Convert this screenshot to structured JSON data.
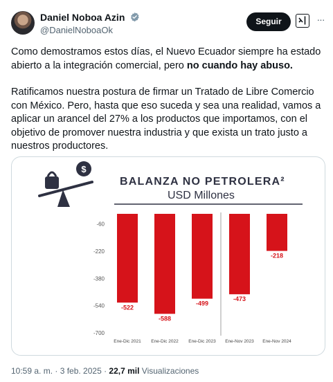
{
  "author": {
    "display_name": "Daniel Noboa Azin",
    "handle": "@DanielNoboaOk"
  },
  "actions": {
    "follow_label": "Seguir",
    "more_label": "···"
  },
  "tweet": {
    "paragraph1_pre": "Como demostramos estos días, el Nuevo Ecuador siempre ha estado abierto a la integración comercial, pero ",
    "paragraph1_bold": "no cuando hay abuso.",
    "paragraph2": "Ratificamos nuestra postura de firmar un Tratado de Libre Comercio con México. Pero, hasta que eso suceda y sea una realidad, vamos a aplicar un arancel del 27% a los productos que importamos, con el objetivo de promover nuestra industria y que exista un trato justo a nuestros productores."
  },
  "meta": {
    "time_date": "10:59 a. m. · 3 feb. 2025 · ",
    "views_count": "22,7 mil",
    "views_label": " Visualizaciones"
  },
  "colors": {
    "bar": "#d6131a",
    "chart_title": "#2e3142",
    "follow_bg": "#0f1419"
  },
  "chart_data": {
    "type": "bar",
    "title": "BALANZA NO PETROLERA²",
    "subtitle": "USD Millones",
    "categories": [
      "Ene-Dic 2021",
      "Ene-Dic 2022",
      "Ene-Dic 2023",
      "Ene-Nov 2023",
      "Ene-Nov 2024"
    ],
    "values": [
      -522,
      -588,
      -499,
      -473,
      -218
    ],
    "value_labels": [
      "-522",
      "-588",
      "-499",
      "-473",
      "-218"
    ],
    "y_ticks": [
      -60,
      -220,
      -380,
      -540,
      -700
    ],
    "y_tick_labels": [
      "-60",
      "-220",
      "-380",
      "-540",
      "-700"
    ],
    "ylim": [
      -700,
      0
    ]
  }
}
